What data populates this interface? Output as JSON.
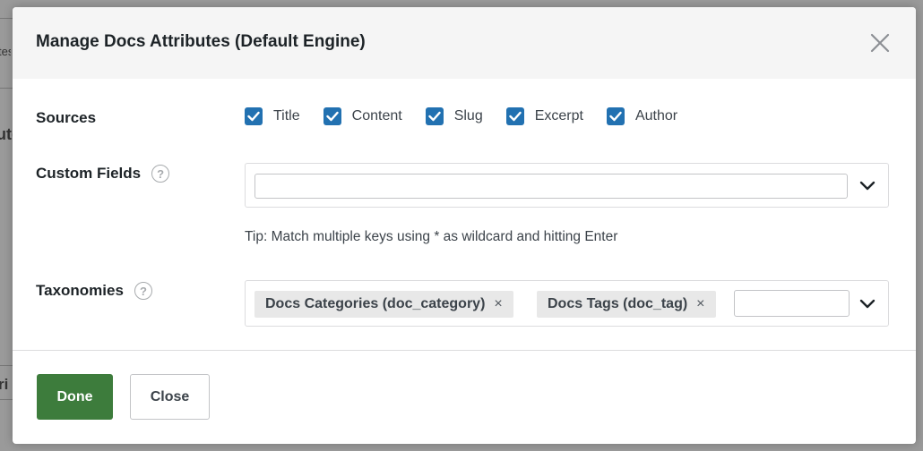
{
  "modal": {
    "title": "Manage Docs Attributes (Default Engine)"
  },
  "sources": {
    "label": "Sources",
    "options": [
      {
        "label": "Title",
        "checked": true
      },
      {
        "label": "Content",
        "checked": true
      },
      {
        "label": "Slug",
        "checked": true
      },
      {
        "label": "Excerpt",
        "checked": true
      },
      {
        "label": "Author",
        "checked": true
      }
    ]
  },
  "custom_fields": {
    "label": "Custom Fields",
    "help": "?",
    "value": "",
    "tip": "Tip: Match multiple keys using * as wildcard and hitting Enter"
  },
  "taxonomies": {
    "label": "Taxonomies",
    "help": "?",
    "tags": [
      {
        "label": "Docs Categories (doc_category)",
        "remove": "×"
      },
      {
        "label": "Docs Tags (doc_tag)",
        "remove": "×"
      }
    ],
    "value": ""
  },
  "footer": {
    "done_label": "Done",
    "close_label": "Close"
  },
  "background": {
    "fragments": [
      "tes",
      "ute",
      "ri"
    ]
  },
  "colors": {
    "checkbox": "#2271b1",
    "done_button": "#3d7c3c"
  }
}
